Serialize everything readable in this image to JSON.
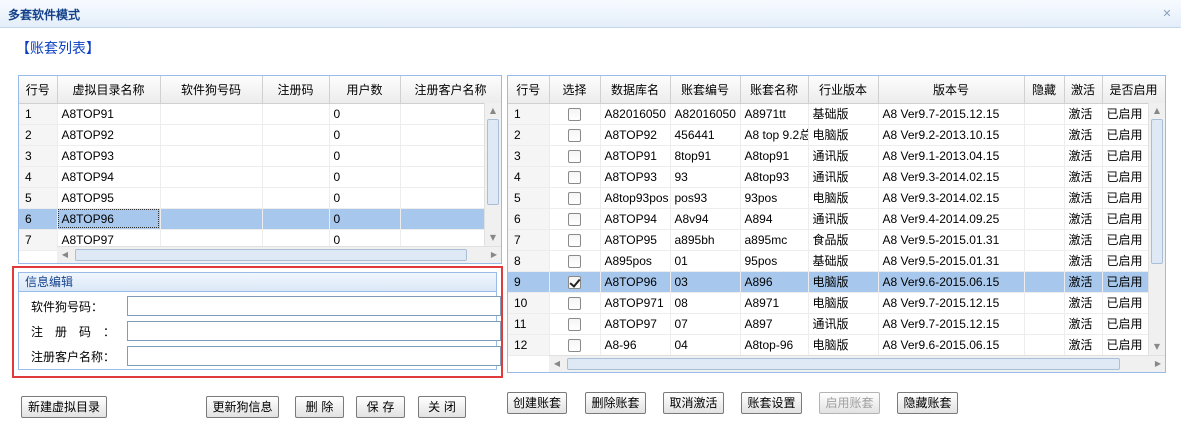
{
  "window": {
    "title": "多套软件模式",
    "close_icon": "close-icon"
  },
  "list_title": "【账套列表】",
  "left_grid": {
    "columns": [
      "行号",
      "虚拟目录名称",
      "软件狗号码",
      "注册码",
      "用户数",
      "注册客户名称"
    ],
    "rows": [
      [
        "1",
        "A8TOP91",
        "",
        "",
        "0",
        ""
      ],
      [
        "2",
        "A8TOP92",
        "",
        "",
        "0",
        ""
      ],
      [
        "3",
        "A8TOP93",
        "",
        "",
        "0",
        ""
      ],
      [
        "4",
        "A8TOP94",
        "",
        "",
        "0",
        ""
      ],
      [
        "5",
        "A8TOP95",
        "",
        "",
        "0",
        ""
      ],
      [
        "6",
        "A8TOP96",
        "",
        "",
        "0",
        ""
      ],
      [
        "7",
        "A8TOP97",
        "",
        "",
        "0",
        ""
      ]
    ],
    "selected_row": 5
  },
  "edit": {
    "header": "信息编辑",
    "dog_label": "软件狗号码：",
    "reg_label": "注　册　码　：",
    "customer_label": "注册客户名称：",
    "dog_value": "",
    "reg_value": "",
    "customer_value": ""
  },
  "right_grid": {
    "columns": [
      "行号",
      "选择",
      "数据库名",
      "账套编号",
      "账套名称",
      "行业版本",
      "版本号",
      "隐藏",
      "激活",
      "是否启用"
    ],
    "rows": [
      [
        "1",
        false,
        "A82016050",
        "A82016050",
        "A8971tt",
        "基础版",
        "A8 Ver9.7-2015.12.15",
        "",
        "激活",
        "已启用"
      ],
      [
        "2",
        false,
        "A8TOP92",
        "456441",
        "A8 top 9.2总",
        "电脑版",
        "A8 Ver9.2-2013.10.15",
        "",
        "激活",
        "已启用"
      ],
      [
        "3",
        false,
        "A8TOP91",
        "8top91",
        "A8top91",
        "通讯版",
        "A8 Ver9.1-2013.04.15",
        "",
        "激活",
        "已启用"
      ],
      [
        "4",
        false,
        "A8TOP93",
        "93",
        "A8top93",
        "通讯版",
        "A8 Ver9.3-2014.02.15",
        "",
        "激活",
        "已启用"
      ],
      [
        "5",
        false,
        "A8top93pos",
        "pos93",
        "93pos",
        "电脑版",
        "A8 Ver9.3-2014.02.15",
        "",
        "激活",
        "已启用"
      ],
      [
        "6",
        false,
        "A8TOP94",
        "A8v94",
        "A894",
        "通讯版",
        "A8 Ver9.4-2014.09.25",
        "",
        "激活",
        "已启用"
      ],
      [
        "7",
        false,
        "A8TOP95",
        "a895bh",
        "a895mc",
        "食品版",
        "A8 Ver9.5-2015.01.31",
        "",
        "激活",
        "已启用"
      ],
      [
        "8",
        false,
        "A895pos",
        "01",
        "95pos",
        "基础版",
        "A8 Ver9.5-2015.01.31",
        "",
        "激活",
        "已启用"
      ],
      [
        "9",
        true,
        "A8TOP96",
        "03",
        "A896",
        "电脑版",
        "A8 Ver9.6-2015.06.15",
        "",
        "激活",
        "已启用"
      ],
      [
        "10",
        false,
        "A8TOP971",
        "08",
        "A8971",
        "电脑版",
        "A8 Ver9.7-2015.12.15",
        "",
        "激活",
        "已启用"
      ],
      [
        "11",
        false,
        "A8TOP97",
        "07",
        "A897",
        "通讯版",
        "A8 Ver9.7-2015.12.15",
        "",
        "激活",
        "已启用"
      ],
      [
        "12",
        false,
        "A8-96",
        "04",
        "A8top-96",
        "电脑版",
        "A8 Ver9.6-2015.06.15",
        "",
        "激活",
        "已启用"
      ]
    ],
    "selected_row": 8
  },
  "buttons_left": {
    "new_dir": "新建虚拟目录",
    "update_dog": "更新狗信息",
    "delete": "删 除",
    "save": "保 存",
    "close": "关 闭"
  },
  "buttons_right": {
    "create": "创建账套",
    "delete": "删除账套",
    "cancel_activate": "取消激活",
    "settings": "账套设置",
    "enable": "启用账套",
    "hide": "隐藏账套"
  }
}
